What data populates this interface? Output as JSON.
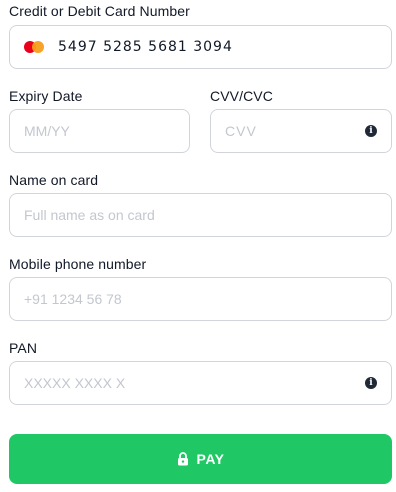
{
  "card_number": {
    "label": "Credit or Debit Card Number",
    "value": "5497 5285 5681 3094",
    "brand_icon": "mastercard-icon"
  },
  "expiry": {
    "label": "Expiry Date",
    "placeholder": "MM/YY"
  },
  "cvv": {
    "label": "CVV/CVC",
    "placeholder": "CVV",
    "info_icon": "info-icon"
  },
  "name": {
    "label": "Name on card",
    "placeholder": "Full name as on card"
  },
  "mobile": {
    "label": "Mobile phone number",
    "placeholder": "+91 1234 56 78"
  },
  "pan": {
    "label": "PAN",
    "placeholder": "XXXXX XXXX X",
    "info_icon": "info-icon"
  },
  "pay_button": {
    "label": "PAY",
    "icon": "lock-icon",
    "color": "#1fc865"
  }
}
